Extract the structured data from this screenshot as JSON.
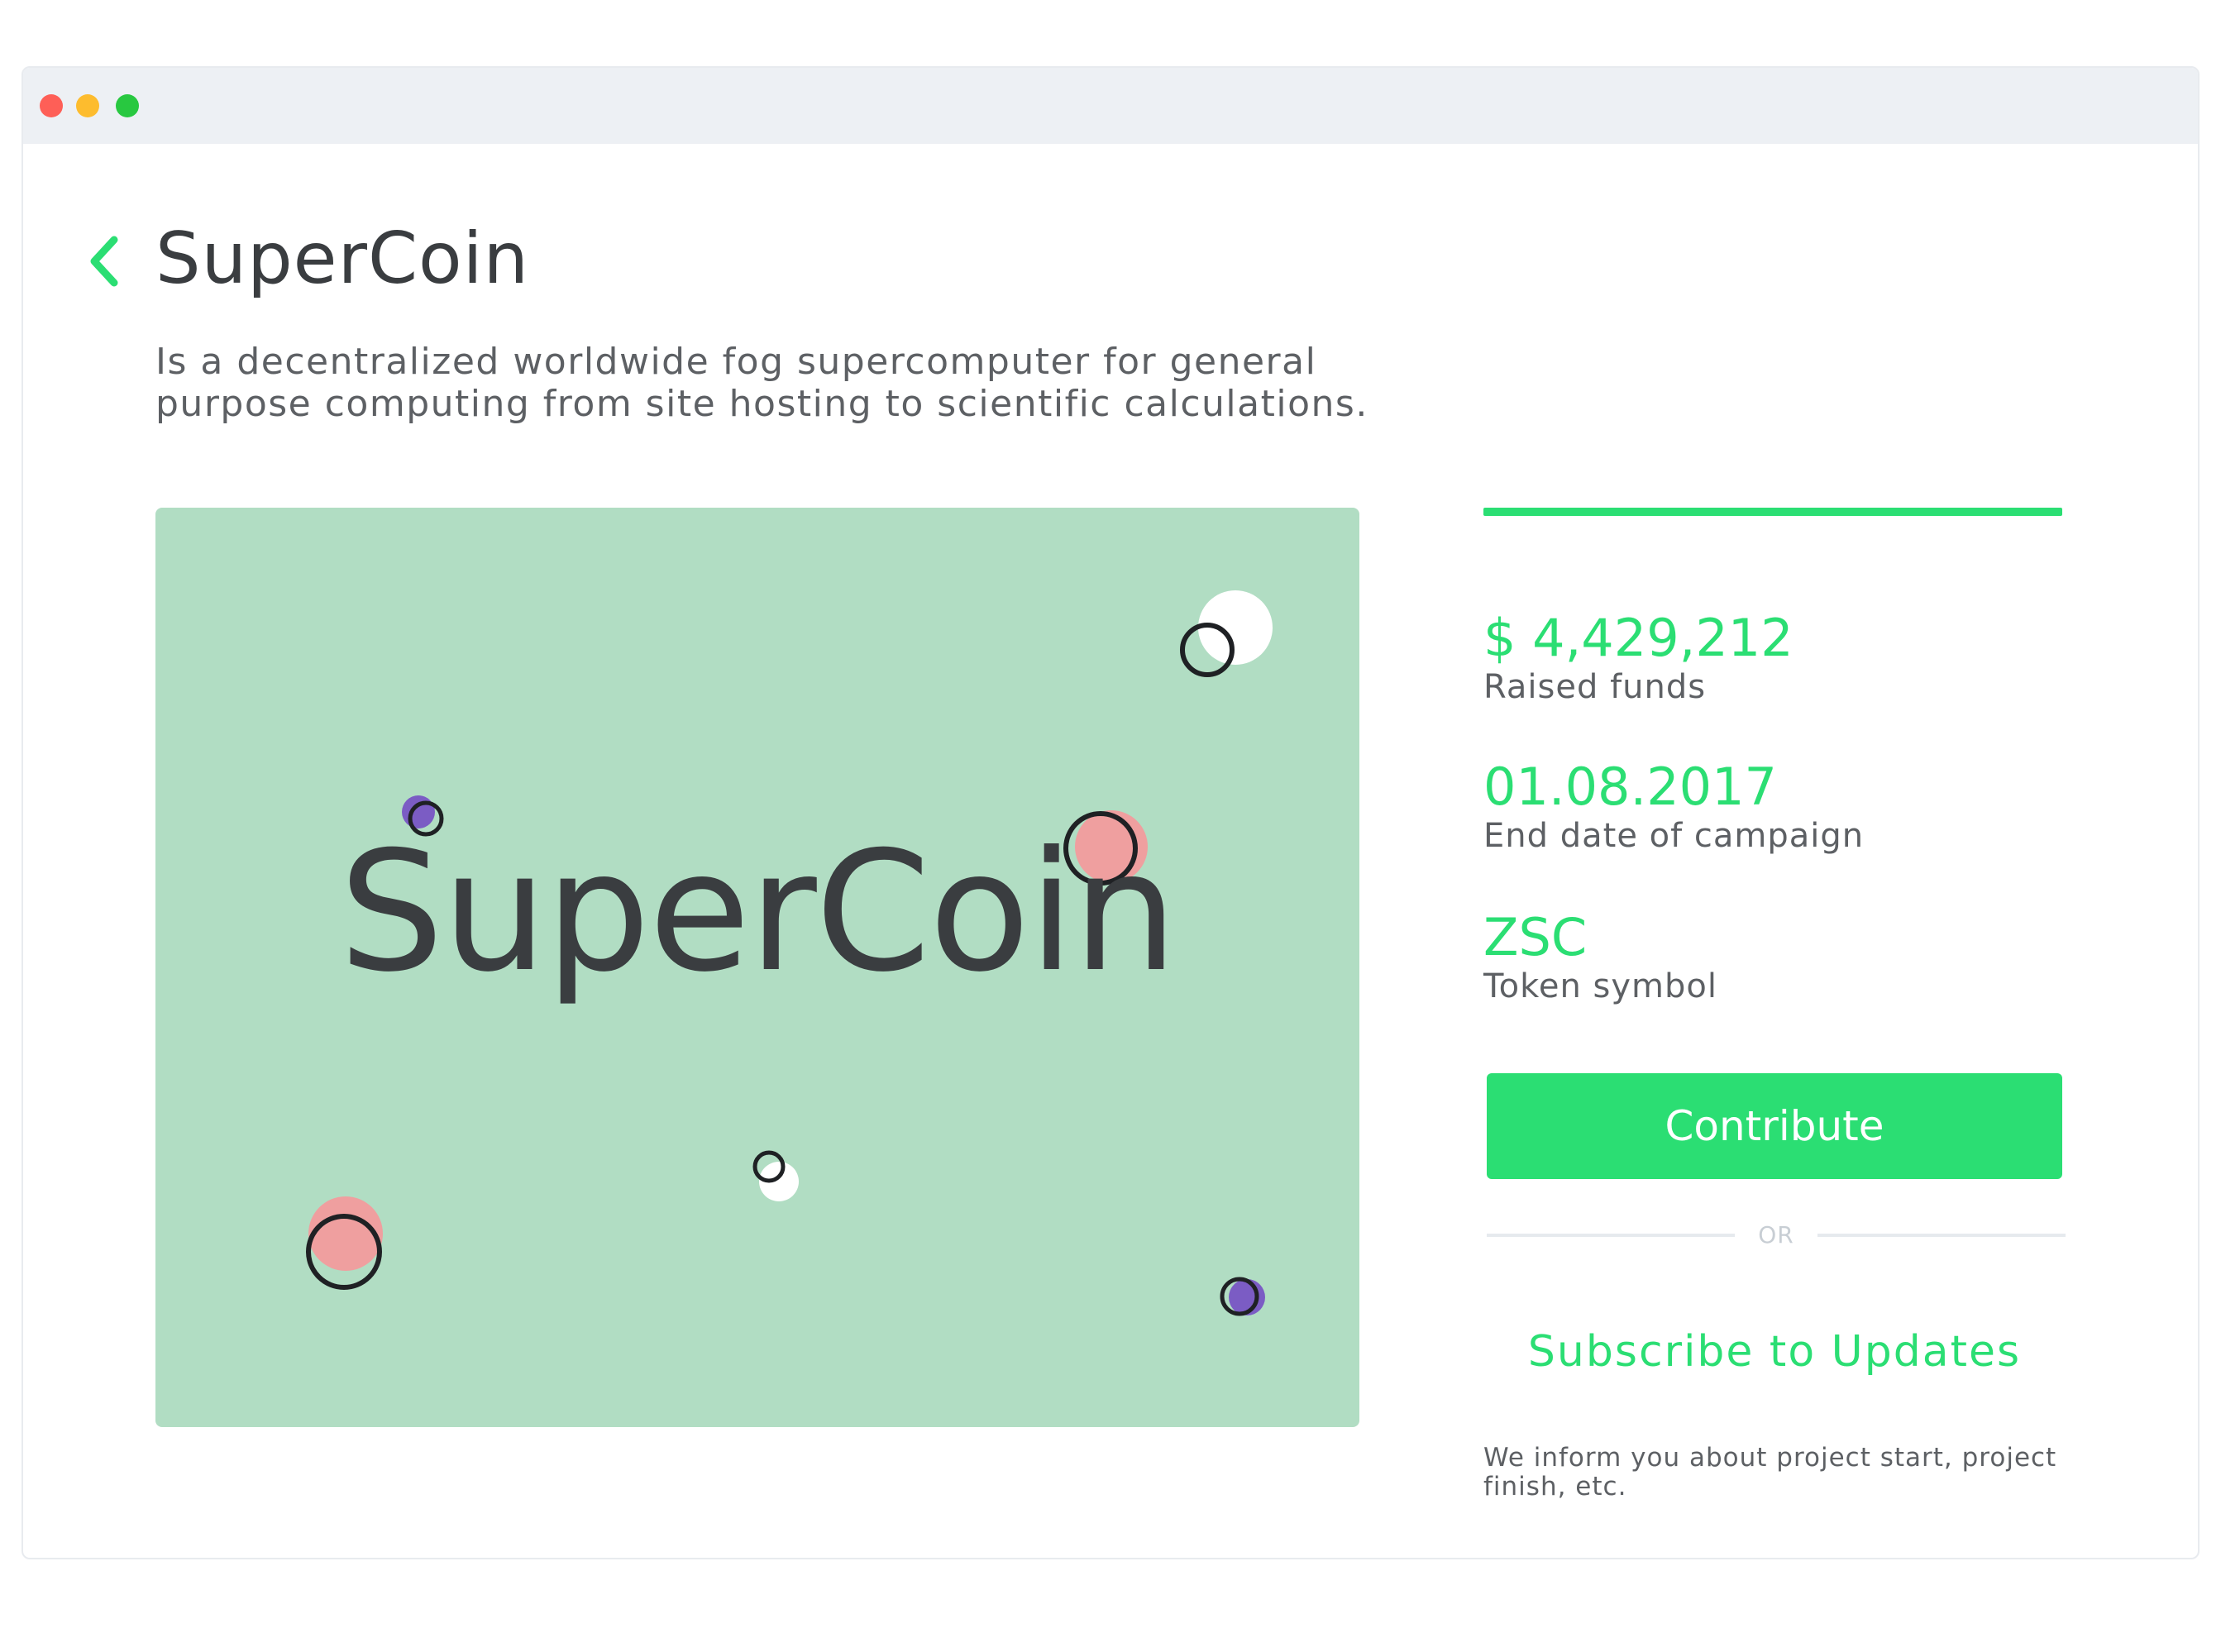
{
  "window": {
    "controls": [
      "close",
      "minimize",
      "maximize"
    ]
  },
  "header": {
    "back_icon": "chevron-left-icon",
    "title": "SuperCoin",
    "description": "Is a decentralized worldwide fog supercomputer for general purpose computing from site hosting to scientific calculations."
  },
  "hero": {
    "logo_text": "SuperCoin"
  },
  "stats": {
    "progress": 1.0,
    "raised_value": "$ 4,429,212",
    "raised_label": "Raised funds",
    "end_date_value": "01.08.2017",
    "end_date_label": "End date of campaign",
    "token_value": "ZSC",
    "token_label": "Token symbol"
  },
  "actions": {
    "contribute_label": "Contribute",
    "or_label": "OR",
    "subscribe_label": "Subscribe to Updates",
    "subscribe_note": "We inform you about project start, project finish, etc."
  },
  "colors": {
    "accent": "#2bde73",
    "hero_bg": "#b1ddc3",
    "text_dark": "#3a3d40",
    "text_body": "#5d6064"
  }
}
